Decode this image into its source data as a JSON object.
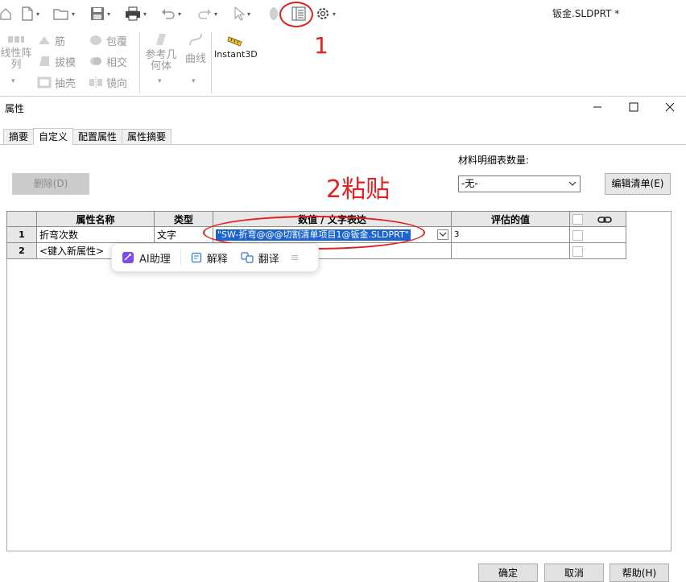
{
  "document": {
    "title": "钣金.SLDPRT *"
  },
  "ribbon": {
    "linear_pattern": "线性阵列",
    "rib": "筋",
    "wrap": "包覆",
    "draft": "拔模",
    "intersect": "相交",
    "shell": "抽壳",
    "mirror": "镜向",
    "ref_geometry": "参考几何体",
    "curves": "曲线",
    "instant3d": "Instant3D"
  },
  "annotations": {
    "step1": "1",
    "step2": "2粘贴",
    "color": "#e42020"
  },
  "dialog": {
    "title": "属性",
    "tabs": [
      "摘要",
      "自定义",
      "配置属性",
      "属性摘要"
    ],
    "active_tab": "自定义",
    "delete_label": "删除(D)",
    "bom_qty_label": "材料明细表数量:",
    "bom_qty_value": "-无-",
    "edit_list_label": "编辑清单(E)",
    "columns": [
      "属性名称",
      "类型",
      "数值 / 文字表达",
      "评估的值"
    ],
    "rows": [
      {
        "num": "1",
        "name": "折弯次数",
        "type": "文字",
        "value": "\"SW-折弯@@@切割清单项目1@钣金.SLDPRT\"",
        "evaluated": "3"
      },
      {
        "num": "2",
        "name": "<键入新属性>",
        "type": "",
        "value": "",
        "evaluated": ""
      }
    ],
    "ok_label": "确定",
    "cancel_label": "取消",
    "help_label": "帮助(H)"
  },
  "ai_popup": {
    "ai_assist": "AI助理",
    "explain": "解释",
    "translate": "翻译"
  },
  "colors": {
    "selection": "#1a64d0",
    "header_bg": "#e7e7e7",
    "accent_purple": "#7b4df0"
  }
}
